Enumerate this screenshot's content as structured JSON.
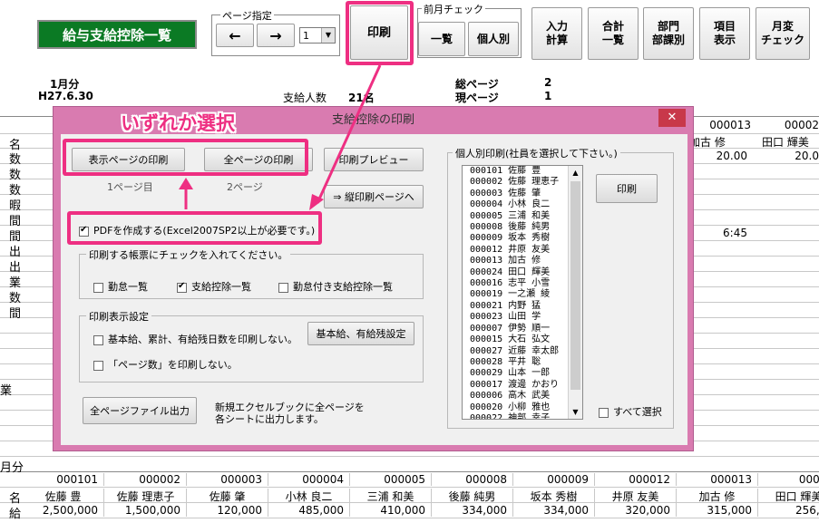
{
  "toolbar": {
    "title_button": "給与支給控除一覧",
    "page_group_label": "ページ指定",
    "prev_arrow": "←",
    "next_arrow": "→",
    "page_select_value": "1",
    "print_button": "印刷",
    "prev_month_group_label": "前月チェック",
    "list_button": "一覧",
    "individual_button": "個人別",
    "input_calc_button": "入力\n計算",
    "total_list_button": "合計\n一覧",
    "dept_button": "部門\n部課別",
    "item_display_button": "項目\n表示",
    "monthly_change_button": "月変\nチェック"
  },
  "header": {
    "month": "1月分",
    "date": "H27.6.30",
    "pay_count_label": "支給人数",
    "pay_count_value": "21名",
    "total_pages_label": "総ページ",
    "total_pages_value": "2",
    "current_page_label": "現ページ",
    "current_page_value": "1"
  },
  "sheet_left_labels": [
    "名",
    "数",
    "数",
    "数",
    "暇",
    "間",
    "間",
    "出",
    "出",
    "業",
    "数",
    "間",
    "業",
    "月分",
    "名",
    "給"
  ],
  "sheet_top_right": {
    "code1": "000013",
    "code2": "00002",
    "name1": "加古 修",
    "name2": "田口 輝美",
    "val1": "20.00",
    "val2": "20.0",
    "time": "6:45"
  },
  "bottom_table": {
    "codes": [
      "000101",
      "000002",
      "000003",
      "000004",
      "000005",
      "000008",
      "000009",
      "000012",
      "000013",
      "00002"
    ],
    "names": [
      "佐藤 豊",
      "佐藤 理恵子",
      "佐藤 肇",
      "小林 良二",
      "三浦 和美",
      "後藤 純男",
      "坂本 秀樹",
      "井原 友美",
      "加古 修",
      "田口 輝美"
    ],
    "salaries": [
      "2,500,000",
      "1,500,000",
      "120,000",
      "485,000",
      "410,000",
      "334,000",
      "334,000",
      "320,000",
      "315,000",
      "256,00"
    ]
  },
  "callout_text": "いずれか選択",
  "dialog": {
    "title": "支給控除の印刷",
    "close": "✕",
    "print_display_page": "表示ページの印刷",
    "print_all_pages": "全ページの印刷",
    "page_label_1": "1ページ目",
    "page_label_2": "2ページ",
    "print_preview": "印刷プレビュー",
    "vertical_print": "⇒ 縦印刷ページへ",
    "pdf_checkbox": "PDFを作成する(Excel2007SP2以上が必要です。)",
    "pdf_checked": true,
    "forms_group": "印刷する帳票にチェックを入れてください。",
    "form_attendance": "勤怠一覧",
    "form_payment": "支給控除一覧",
    "form_payment_checked": true,
    "form_attendance_payment": "勤怠付き支給控除一覧",
    "display_settings_group": "印刷表示設定",
    "setting_no_base": "基本給、累計、有給残日数を印刷しない。",
    "setting_no_pagecount": "「ページ数」を印刷しない。",
    "base_salary_setting_button": "基本給、有給残設定",
    "all_pages_file_output": "全ページファイル出力",
    "file_output_note": "新規エクセルブックに全ページを\n各シートに出力します。",
    "individual_group": "個人別印刷(社員を選択して下さい。)",
    "individual_print_button": "印刷",
    "select_all": "すべて選択",
    "employees": [
      "000101 佐藤 豊",
      "000002 佐藤 理恵子",
      "000003 佐藤 肇",
      "000004 小林 良二",
      "000005 三浦 和美",
      "000008 後藤 純男",
      "000009 坂本 秀樹",
      "000012 井原 友美",
      "000013 加古 修",
      "000024 田口 輝美",
      "000016 志平 小雪",
      "000019 一之瀬 綾",
      "000021 内野 猛",
      "000023 山田 学",
      "000007 伊勢 順一",
      "000015 大石 弘文",
      "000027 近藤 幸太郎",
      "000028 平井 聡",
      "000029 山本 一郎",
      "000017 渡邊 かおり",
      "000006 高木 武美",
      "000020 小柳 雅也",
      "000022 神部 幸子"
    ]
  },
  "colors": {
    "accent": "#ee2f82",
    "dialog_frame": "#d97bb0",
    "title_green": "#0b7a24"
  }
}
